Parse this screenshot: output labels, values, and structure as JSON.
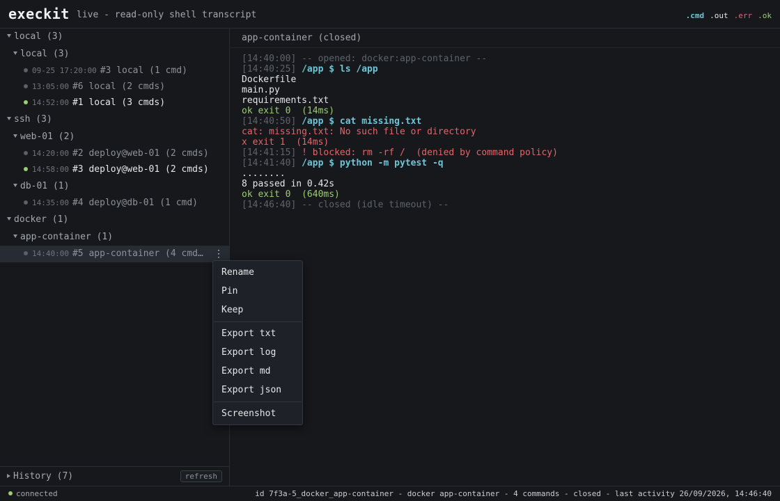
{
  "header": {
    "app_title": "execkit",
    "subtitle": "live - read-only shell transcript",
    "legend": [
      {
        "label": ".cmd",
        "color": "#6fc4d6"
      },
      {
        "label": ".out",
        "color": "#e6e7ea"
      },
      {
        "label": ".err",
        "color": "#e0676b"
      },
      {
        "label": ".ok",
        "color": "#9ccc73"
      }
    ]
  },
  "sidebar": {
    "groups": [
      {
        "label": "local (3)"
      },
      {
        "label": "local (3)"
      },
      {
        "label": "ssh (3)"
      },
      {
        "label": "web-01 (2)"
      },
      {
        "label": "db-01 (1)"
      },
      {
        "label": "docker (1)"
      },
      {
        "label": "app-container (1)"
      }
    ],
    "sessions": [
      {
        "time": "09-25 17:20:00",
        "name": "#3 local (1 cmd)",
        "live": false
      },
      {
        "time": "13:05:00",
        "name": "#6 local (2 cmds)",
        "live": false
      },
      {
        "time": "14:52:00",
        "name": "#1 local (3 cmds)",
        "live": true
      },
      {
        "time": "14:20:00",
        "name": "#2 deploy@web-01 (2 cmds)",
        "live": false
      },
      {
        "time": "14:58:00",
        "name": "#3 deploy@web-01 (2 cmds)",
        "live": true
      },
      {
        "time": "14:35:00",
        "name": "#4 deploy@db-01 (1 cmd)",
        "live": false
      },
      {
        "time": "14:40:00",
        "name": "#5 app-container (4 cmd…",
        "live": false
      }
    ],
    "kebab_glyph": "⋮",
    "history_label": "History (7)",
    "refresh_label": "refresh"
  },
  "main": {
    "title": "app-container (closed)",
    "transcript": [
      {
        "ts": "[14:40:00]",
        "kind": "sys",
        "text": " -- opened: docker:app-container --"
      },
      {
        "ts": "[14:40:25]",
        "kind": "cmd",
        "text": " /app $ ls /app"
      },
      {
        "ts": "",
        "kind": "out",
        "text": "Dockerfile"
      },
      {
        "ts": "",
        "kind": "out",
        "text": "main.py"
      },
      {
        "ts": "",
        "kind": "out",
        "text": "requirements.txt"
      },
      {
        "ts": "",
        "kind": "ok",
        "text": "ok exit 0  (14ms)"
      },
      {
        "ts": "[14:40:50]",
        "kind": "cmd",
        "text": " /app $ cat missing.txt"
      },
      {
        "ts": "",
        "kind": "err",
        "text": "cat: missing.txt: No such file or directory"
      },
      {
        "ts": "",
        "kind": "err",
        "text": "x exit 1  (14ms)"
      },
      {
        "ts": "[14:41:15]",
        "kind": "err",
        "text": " ! blocked: rm -rf /  (denied by command policy)"
      },
      {
        "ts": "[14:41:40]",
        "kind": "cmd",
        "text": " /app $ python -m pytest -q"
      },
      {
        "ts": "",
        "kind": "out",
        "text": "........"
      },
      {
        "ts": "",
        "kind": "out",
        "text": "8 passed in 0.42s"
      },
      {
        "ts": "",
        "kind": "ok",
        "text": "ok exit 0  (640ms)"
      },
      {
        "ts": "[14:46:40]",
        "kind": "sys",
        "text": " -- closed (idle timeout) --"
      }
    ]
  },
  "context_menu": {
    "items": [
      "Rename",
      "Pin",
      "Keep",
      "Export txt",
      "Export log",
      "Export md",
      "Export json",
      "Screenshot"
    ]
  },
  "statusbar": {
    "connection": "connected",
    "details": "id 7f3a-5_docker_app-container - docker app-container - 4 commands - closed - last activity 26/09/2026, 14:46:40"
  }
}
